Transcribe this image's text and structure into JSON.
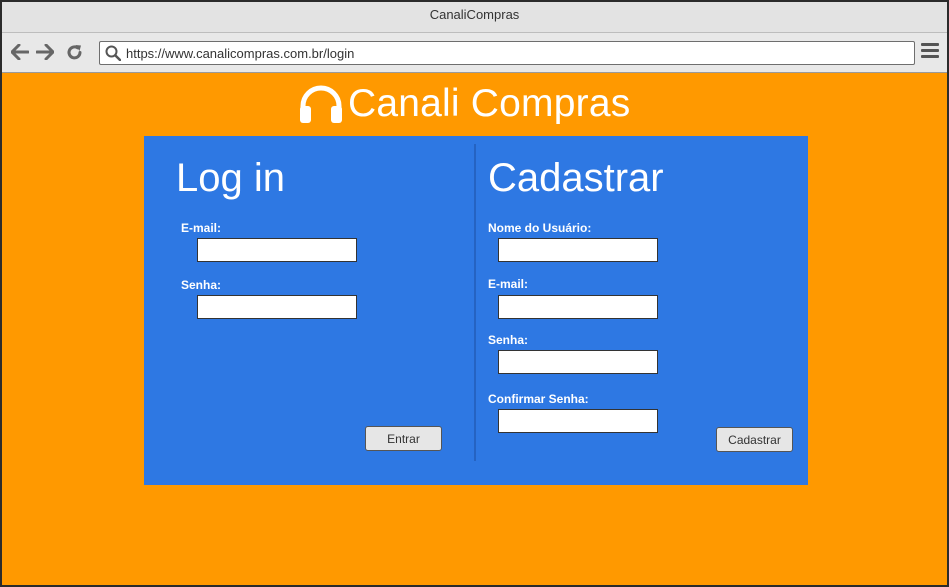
{
  "window": {
    "title": "CanaliCompras"
  },
  "browser": {
    "url": "https://www.canalicompras.com.br/login"
  },
  "brand": {
    "name": "Canali Compras"
  },
  "login": {
    "title": "Log in",
    "email_label": "E-mail:",
    "email_value": "",
    "password_label": "Senha:",
    "password_value": "",
    "submit_label": "Entrar"
  },
  "register": {
    "title": "Cadastrar",
    "username_label": "Nome do Usuário:",
    "username_value": "",
    "email_label": "E-mail:",
    "email_value": "",
    "password_label": "Senha:",
    "password_value": "",
    "confirm_label": "Confirmar Senha:",
    "confirm_value": "",
    "submit_label": "Cadastrar"
  },
  "colors": {
    "page_background": "#ff9900",
    "panel_background": "#2e78e3",
    "text": "#ffffff"
  },
  "icons": {
    "back": "arrow-left-icon",
    "forward": "arrow-right-icon",
    "reload": "reload-icon",
    "search": "search-icon",
    "menu": "hamburger-menu-icon",
    "brand": "headphones-icon"
  }
}
